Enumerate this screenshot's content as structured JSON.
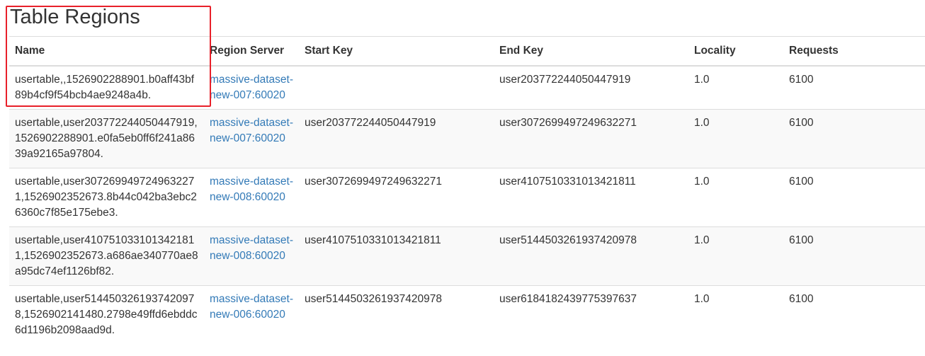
{
  "page": {
    "title": "Table Regions"
  },
  "table": {
    "headers": {
      "name": "Name",
      "region_server": "Region Server",
      "start_key": "Start Key",
      "end_key": "End Key",
      "locality": "Locality",
      "requests": "Requests"
    },
    "rows": [
      {
        "name": "usertable,,1526902288901.b0aff43bf89b4cf9f54bcb4ae9248a4b.",
        "server_line1": "massive-dataset-",
        "server_line2": "new-007:60020",
        "start_key": "",
        "end_key": "user203772244050447919",
        "locality": "1.0",
        "requests": "6100"
      },
      {
        "name": "usertable,user203772244050447919,1526902288901.e0fa5eb0ff6f241a8639a92165a97804.",
        "server_line1": "massive-dataset-",
        "server_line2": "new-007:60020",
        "start_key": "user203772244050447919",
        "end_key": "user3072699497249632271",
        "locality": "1.0",
        "requests": "6100"
      },
      {
        "name": "usertable,user3072699497249632271,1526902352673.8b44c042ba3ebc26360c7f85e175ebe3.",
        "server_line1": "massive-dataset-",
        "server_line2": "new-008:60020",
        "start_key": "user3072699497249632271",
        "end_key": "user4107510331013421811",
        "locality": "1.0",
        "requests": "6100"
      },
      {
        "name": "usertable,user4107510331013421811,1526902352673.a686ae340770ae8a95dc74ef1126bf82.",
        "server_line1": "massive-dataset-",
        "server_line2": "new-008:60020",
        "start_key": "user4107510331013421811",
        "end_key": "user5144503261937420978",
        "locality": "1.0",
        "requests": "6100"
      },
      {
        "name": "usertable,user5144503261937420978,1526902141480.2798e49ffd6ebddc6d1196b2098aad9d.",
        "server_line1": "massive-dataset-",
        "server_line2": "new-006:60020",
        "start_key": "user5144503261937420978",
        "end_key": "user6184182439775397637",
        "locality": "1.0",
        "requests": "6100"
      }
    ]
  },
  "colors": {
    "link": "#337ab7",
    "highlight_border": "#e8202a",
    "table_border": "#dddddd",
    "striped_row": "#f9f9f9"
  }
}
